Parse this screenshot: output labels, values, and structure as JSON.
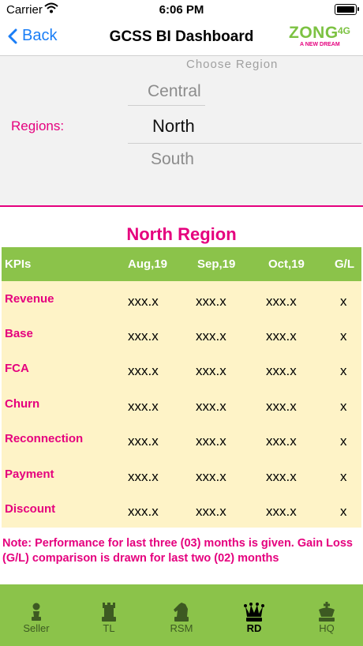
{
  "status_bar": {
    "carrier": "Carrier",
    "time": "6:06 PM"
  },
  "nav": {
    "back_label": "Back",
    "title": "GCSS BI Dashboard"
  },
  "logo": {
    "brand": "ZONG",
    "suffix": "4G",
    "tagline": "A NEW DREAM"
  },
  "region_picker": {
    "title": "Choose Region",
    "label": "Regions:",
    "options": [
      "Central",
      "North",
      "South"
    ],
    "selected": "North"
  },
  "kpi_table": {
    "title": "North Region",
    "columns": [
      "KPIs",
      "Aug,19",
      "Sep,19",
      "Oct,19",
      "G/L"
    ],
    "rows": [
      {
        "kpi": "Revenue",
        "aug": "xxx.x",
        "sep": "xxx.x",
        "oct": "xxx.x",
        "gl": "x"
      },
      {
        "kpi": "Base",
        "aug": "xxx.x",
        "sep": "xxx.x",
        "oct": "xxx.x",
        "gl": "x"
      },
      {
        "kpi": "FCA",
        "aug": "xxx.x",
        "sep": "xxx.x",
        "oct": "xxx.x",
        "gl": "x"
      },
      {
        "kpi": "Churn",
        "aug": "xxx.x",
        "sep": "xxx.x",
        "oct": "xxx.x",
        "gl": "x"
      },
      {
        "kpi": "Reconnection",
        "aug": "xxx.x",
        "sep": "xxx.x",
        "oct": "xxx.x",
        "gl": "x"
      },
      {
        "kpi": "Payment",
        "aug": "xxx.x",
        "sep": "xxx.x",
        "oct": "xxx.x",
        "gl": "x"
      },
      {
        "kpi": "Discount",
        "aug": "xxx.x",
        "sep": "xxx.x",
        "oct": "xxx.x",
        "gl": "x"
      }
    ],
    "note": "Note: Performance for last three (03) months is given. Gain Loss (G/L) comparison is drawn for last two (02) months"
  },
  "tabs": [
    {
      "label": "Seller",
      "icon": "pawn-icon"
    },
    {
      "label": "TL",
      "icon": "rook-icon"
    },
    {
      "label": "RSM",
      "icon": "knight-icon"
    },
    {
      "label": "RD",
      "icon": "queen-icon",
      "active": true
    },
    {
      "label": "HQ",
      "icon": "king-icon"
    }
  ],
  "colors": {
    "accent_pink": "#e5007e",
    "tab_green": "#8bc34a",
    "table_bg": "#fef3c7",
    "link_blue": "#1a7ef6"
  }
}
